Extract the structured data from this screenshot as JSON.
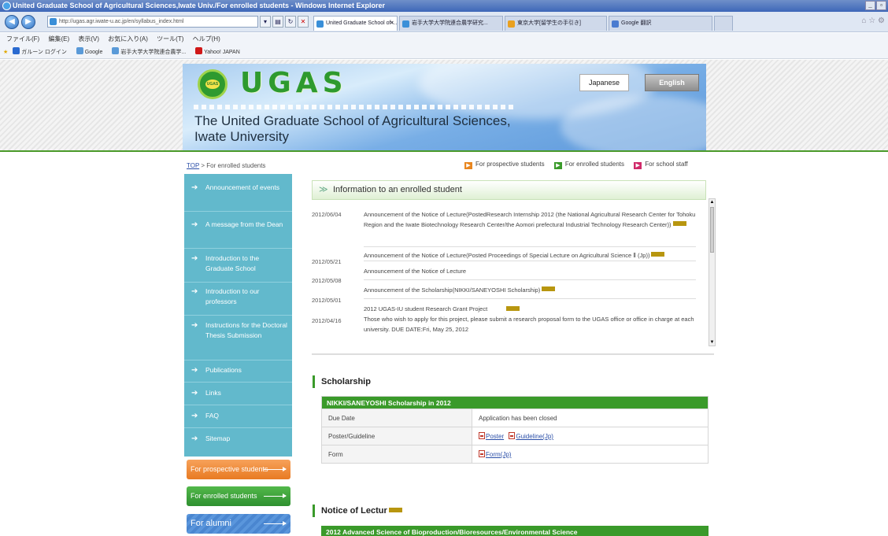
{
  "window": {
    "title": "United Graduate School of Agricultural Sciences,Iwate Univ./For enrolled students - Windows Internet Explorer"
  },
  "browser": {
    "address": "http://ugas.agr.iwate-u.ac.jp/en/syllabus_index.html",
    "tabs": [
      {
        "label": "United Graduate School of ..."
      },
      {
        "label": "岩手大学大学院連合農学研究..."
      },
      {
        "label": "東京大学[留学生の手引き]"
      },
      {
        "label": "Google 翻訳"
      }
    ],
    "menu": [
      "ファイル(F)",
      "編集(E)",
      "表示(V)",
      "お気に入り(A)",
      "ツール(T)",
      "ヘルプ(H)"
    ],
    "favorites": [
      "ガルーン ログイン",
      "Google",
      "岩手大学大学院連合農学...",
      "Yahoo! JAPAN"
    ]
  },
  "header": {
    "logo_text": "UGAS",
    "logo_emblem_text": "UGAS",
    "school_line1": "The United Graduate School of Agricultural Sciences,",
    "school_line2": "Iwate University",
    "lang_japanese": "Japanese",
    "lang_english": "English"
  },
  "breadcrumb": {
    "top": "TOP",
    "separator": " > ",
    "current": "For enrolled students"
  },
  "audience_links": [
    {
      "label": "For prospective students",
      "color": "#e8861f"
    },
    {
      "label": "For enrolled students",
      "color": "#3a9a2a"
    },
    {
      "label": "For school staff",
      "color": "#d02a6a"
    }
  ],
  "sidebar": {
    "items": [
      {
        "label": "Announcement of events"
      },
      {
        "label": "A message from the Dean"
      },
      {
        "label": "Introduction to the Graduate School"
      },
      {
        "label": "Introduction to our professors"
      },
      {
        "label": "Instructions for the Doctoral Thesis Submission"
      },
      {
        "label": "Publications"
      },
      {
        "label": "Links"
      },
      {
        "label": "FAQ"
      },
      {
        "label": "Sitemap"
      }
    ]
  },
  "audience_buttons": [
    {
      "label": "For prospective students",
      "color": "#f08a3a"
    },
    {
      "label": "For enrolled students",
      "color": "#3ba23a"
    },
    {
      "label": "For alumni",
      "color": "#4a86d0"
    }
  ],
  "info": {
    "heading": "Information to an enrolled student",
    "news": [
      {
        "date": "2012/06/04",
        "text": "Announcement of the Notice of Lecture(PostedResearch Internship 2012 (the National Agricultural Research Center for Tohoku Region and the Iwate Biotechnology Research Center/the Aomori prefectural Industrial Technology Research Center))"
      },
      {
        "date": "2012/05/21",
        "text": "Announcement of the Notice of Lecture(Posted Proceedings of Special Lecture on Agricultural Science Ⅱ (Jp))"
      },
      {
        "date": "2012/05/08",
        "text": "Announcement of the Notice of Lecture"
      },
      {
        "date": "2012/05/01",
        "text": "Announcement of the Scholarship(NIKKI/SANEYOSHI Scholarship)"
      },
      {
        "date": "2012/04/16",
        "text": "2012 UGAS-IU student Research Grant Project"
      },
      {
        "date": "",
        "text": "Those who wish to apply for this project, please submit a research proposal form to the UGAS office or office in charge at each university. DUE DATE:Fri, May 25, 2012"
      }
    ]
  },
  "scholarship": {
    "heading": "Scholarship",
    "table_caption": "NIKKI/SANEYOSHI Scholarship in 2012",
    "rows": [
      {
        "label": "Due Date",
        "value": "Application has been closed"
      },
      {
        "label": "Poster/Guideline",
        "links": [
          "Poster",
          "Guideline(Jp)"
        ]
      },
      {
        "label": "Form",
        "links": [
          "Form(Jp)"
        ]
      }
    ]
  },
  "lecture": {
    "heading": "Notice of Lectur",
    "bar_title": "2012 Advanced Science of Bioproduction/Bioresources/Environmental Science"
  },
  "colors": {
    "brand_green": "#3a9a2a",
    "sidebar_blue": "#62b9cc",
    "link_blue": "#2b4fa8"
  }
}
